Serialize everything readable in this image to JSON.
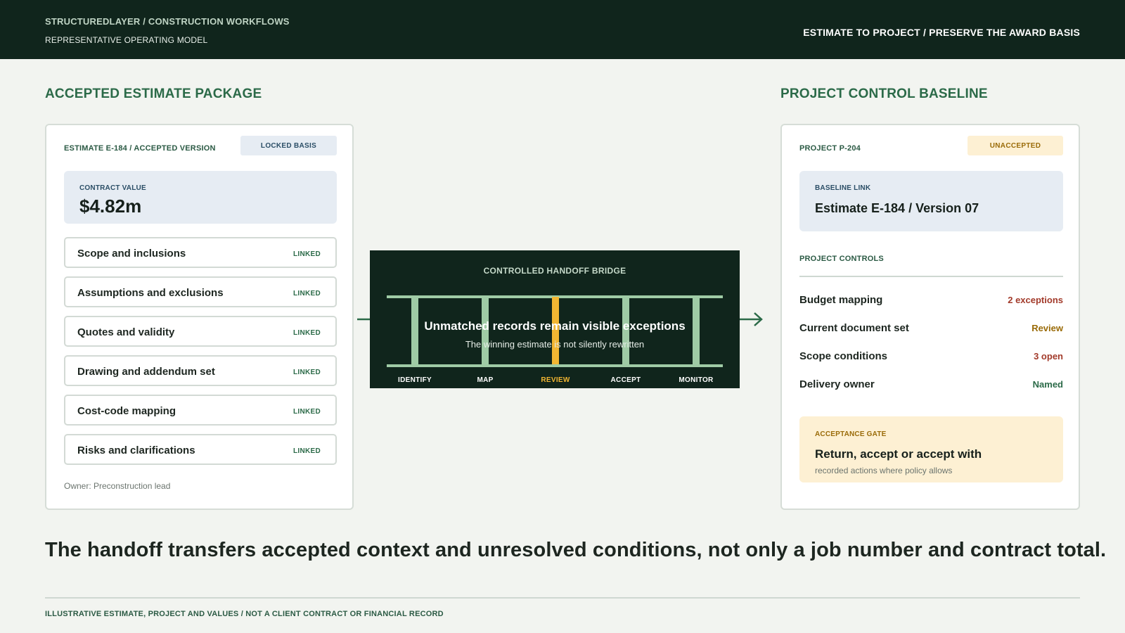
{
  "header": {
    "brand": "STRUCTUREDLAYER / CONSTRUCTION WORKFLOWS",
    "subtitle": "REPRESENTATIVE OPERATING MODEL",
    "right_title": "ESTIMATE TO PROJECT / PRESERVE THE AWARD BASIS"
  },
  "left_panel": {
    "section_title": "ACCEPTED ESTIMATE PACKAGE",
    "card_label": "ESTIMATE E-184 / ACCEPTED VERSION",
    "badge": "LOCKED BASIS",
    "value_label": "CONTRACT VALUE",
    "value": "$4.82m",
    "items": [
      {
        "label": "Scope and inclusions",
        "status": "LINKED"
      },
      {
        "label": "Assumptions and exclusions",
        "status": "LINKED"
      },
      {
        "label": "Quotes and validity",
        "status": "LINKED"
      },
      {
        "label": "Drawing and addendum set",
        "status": "LINKED"
      },
      {
        "label": "Cost-code mapping",
        "status": "LINKED"
      },
      {
        "label": "Risks and clarifications",
        "status": "LINKED"
      }
    ],
    "owner": "Owner: Preconstruction lead"
  },
  "bridge": {
    "title": "CONTROLLED HANDOFF BRIDGE",
    "main_text": "Unmatched records remain visible exceptions",
    "sub_text": "The winning estimate is not silently rewritten",
    "steps": [
      "IDENTIFY",
      "MAP",
      "REVIEW",
      "ACCEPT",
      "MONITOR"
    ],
    "active_step": "REVIEW",
    "colors": {
      "background": "#10251c",
      "rail": "#9fcba5",
      "active": "#f2b632"
    }
  },
  "right_panel": {
    "section_title": "PROJECT CONTROL BASELINE",
    "card_label": "PROJECT P-204",
    "badge": "UNACCEPTED",
    "baseline_label": "BASELINE LINK",
    "baseline_value": "Estimate E-184 / Version 07",
    "controls_label": "PROJECT CONTROLS",
    "controls": [
      {
        "label": "Budget mapping",
        "value": "2 exceptions",
        "color": "#a23a2a"
      },
      {
        "label": "Current document set",
        "value": "Review",
        "color": "#9a6b08"
      },
      {
        "label": "Scope conditions",
        "value": "3 open",
        "color": "#a23a2a"
      },
      {
        "label": "Delivery owner",
        "value": "Named",
        "color": "#2b6a48"
      }
    ],
    "gate": {
      "label": "ACCEPTANCE GATE",
      "title": "Return, accept or accept with",
      "text": "recorded actions where policy allows"
    }
  },
  "headline": "The handoff transfers accepted context and unresolved conditions, not only a job number and contract total.",
  "footer": "ILLUSTRATIVE ESTIMATE, PROJECT AND VALUES / NOT A CLIENT CONTRACT OR FINANCIAL RECORD"
}
